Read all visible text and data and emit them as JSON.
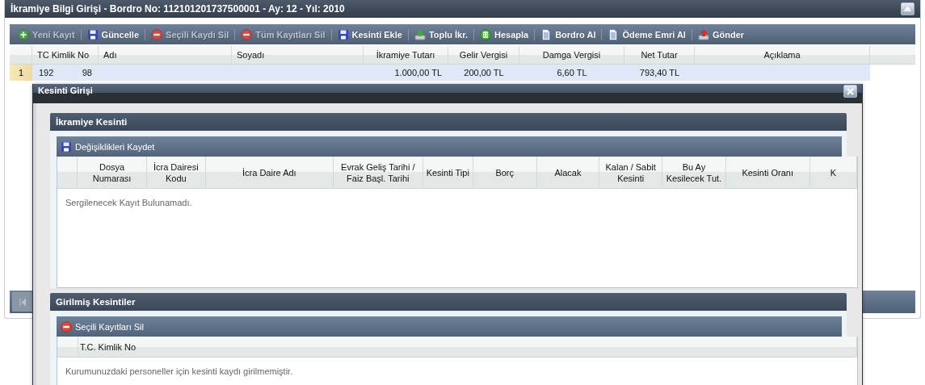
{
  "window": {
    "title": "İkramiye Bilgi Girişi - Bordro No: 112101201737500001 - Ay: 12 - Yıl: 2010"
  },
  "toolbar": [
    {
      "label": "Yeni Kayıt",
      "kind": "add",
      "disabled": true
    },
    {
      "label": "Güncelle",
      "kind": "save",
      "disabled": false
    },
    {
      "label": "Seçili Kaydı Sil",
      "kind": "delete",
      "disabled": true
    },
    {
      "label": "Tüm Kayıtları Sil",
      "kind": "delete",
      "disabled": true
    },
    {
      "label": "Kesinti Ekle",
      "kind": "save",
      "disabled": false
    },
    {
      "label": "Toplu İkr.",
      "kind": "download",
      "disabled": false
    },
    {
      "label": "Hesapla",
      "kind": "calculator",
      "disabled": false
    },
    {
      "label": "Bordro Al",
      "kind": "document",
      "disabled": false
    },
    {
      "label": "Ödeme Emri Al",
      "kind": "document",
      "disabled": false
    },
    {
      "label": "Gönder",
      "kind": "upload",
      "disabled": false
    }
  ],
  "grid": {
    "columns": [
      "TC Kimlik No",
      "Adı",
      "Soyadı",
      "İkramiye Tutarı",
      "Gelir Vergisi",
      "Damga Vergisi",
      "Net Tutar",
      "Açıklama"
    ],
    "rows": [
      {
        "row_number": "1",
        "selected": true,
        "cells": [
          {
            "text": "192",
            "suffix": "98"
          },
          {},
          {},
          {
            "text": "1.000,00 TL"
          },
          {
            "text": "200,00 TL"
          },
          {
            "text": "6,60 TL"
          },
          {
            "text": "793,40 TL"
          },
          {}
        ]
      }
    ]
  },
  "dialog": {
    "title": "Kesinti Girişi",
    "sections": [
      {
        "title": "İkramiye Kesinti",
        "button": {
          "label": "Değişiklikleri Kaydet",
          "kind": "save"
        },
        "columns": [
          "Dosya Numarası",
          "İcra Dairesi Kodu",
          "İcra Daire Adı",
          "Evrak Geliş Tarihi / Faiz Başl. Tarihi",
          "Kesinti Tipi",
          "Borç",
          "Alacak",
          "Kalan / Sabit Kesinti",
          "Bu Ay Kesilecek Tut.",
          "Kesinti Oranı",
          "K"
        ],
        "empty_text": "Sergilenecek Kayıt Bulunamadı."
      },
      {
        "title": "Girilmiş Kesintiler",
        "button": {
          "label": "Seçili Kayıtları Sil",
          "kind": "delete"
        },
        "columns": [
          "T.C. Kimlik No"
        ],
        "empty_text": "Kurumunuzdaki personeller için kesinti kaydı girilmemiştir."
      }
    ]
  }
}
